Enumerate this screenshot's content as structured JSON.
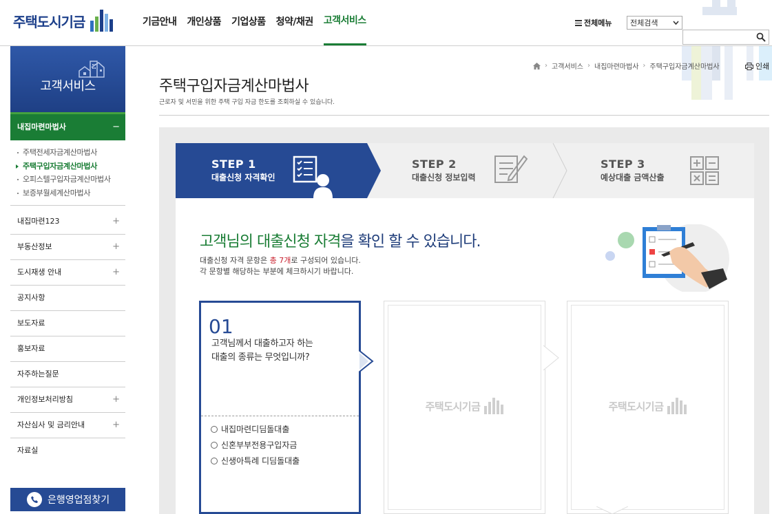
{
  "header": {
    "logo_text": "주택도시기금",
    "nav": [
      "기금안내",
      "개인상품",
      "기업상품",
      "청약/채권",
      "고객서비스"
    ],
    "active_nav_index": 4,
    "all_menu": "전체메뉴",
    "search_select": "전체검색",
    "search_placeholder": ""
  },
  "sidebar": {
    "title": "고객서비스",
    "active_section": "내집마련마법사",
    "active_section_sign": "−",
    "sub_items": [
      "주택전세자금계산마법사",
      "주택구입자금계산마법사",
      "오피스텔구입자금계산마법사",
      "보증부월세계산마법사"
    ],
    "active_sub_index": 1,
    "menu": [
      {
        "label": "내집마련123",
        "sign": "+"
      },
      {
        "label": "부동산정보",
        "sign": "+"
      },
      {
        "label": "도시재생 안내",
        "sign": "+"
      },
      {
        "label": "공지사항",
        "sign": ""
      },
      {
        "label": "보도자료",
        "sign": ""
      },
      {
        "label": "홍보자료",
        "sign": ""
      },
      {
        "label": "자주하는질문",
        "sign": ""
      },
      {
        "label": "개인정보처리방침",
        "sign": "+"
      },
      {
        "label": "자산심사 및 금리안내",
        "sign": "+"
      },
      {
        "label": "자료실",
        "sign": ""
      }
    ],
    "bank_button": "은행영업점찾기"
  },
  "breadcrumb": [
    "고객서비스",
    "내집마련마법사",
    "주택구입자금계산마법사"
  ],
  "print_label": "인쇄",
  "page": {
    "title": "주택구입자금계산마법사",
    "description": "근로자 및 서민을 위한 주택 구입 자금 한도를 조회하실 수 있습니다."
  },
  "steps": [
    {
      "title": "STEP 1",
      "subtitle": "대출신청 자격확인",
      "active": true
    },
    {
      "title": "STEP 2",
      "subtitle": "대출신청 정보입력",
      "active": false
    },
    {
      "title": "STEP 3",
      "subtitle": "예상대출 금액산출",
      "active": false
    }
  ],
  "heading": {
    "part1": "고객님의 대출신청 자격",
    "part2": "을 확인 할 수 있습니다."
  },
  "intro": {
    "line1_pre": "대출신청 자격 문항은 ",
    "line1_hl": "총 7개",
    "line1_post": "로 구성되어 있습니다.",
    "line2": "각 문항별 해당하는 부분에 체크하시기 바랍니다."
  },
  "question": {
    "number": "01",
    "line1": "고객님께서 대출하고자 하는",
    "line2": "대출의 종류는 무엇입니까?",
    "options": [
      "내집마련디딤돌대출",
      "신혼부부전용구입자금",
      "신생아특례 디딤돌대출"
    ]
  },
  "watermark": "주택도시기금",
  "colors": {
    "brand_blue": "#264a94",
    "brand_green": "#1a7d35",
    "highlight_red": "#c8202e"
  }
}
